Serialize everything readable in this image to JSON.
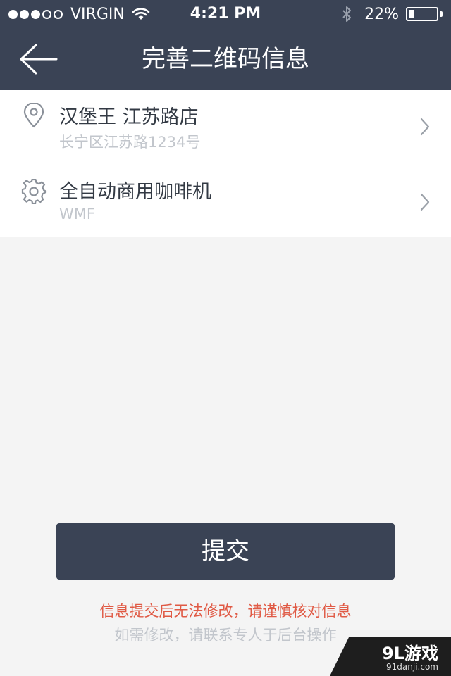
{
  "status_bar": {
    "carrier": "VIRGIN",
    "time": "4:21 PM",
    "battery_percent": "22%",
    "battery_level": 0.22,
    "signal_bars_filled": 3,
    "signal_bars_total": 5,
    "icons": [
      "wifi-icon",
      "bluetooth-icon",
      "battery-icon"
    ]
  },
  "nav": {
    "title": "完善二维码信息",
    "back_icon": "arrow-left-icon"
  },
  "list": {
    "items": [
      {
        "icon": "location-pin-icon",
        "title": "汉堡王 江苏路店",
        "subtitle": "长宁区江苏路1234号"
      },
      {
        "icon": "gear-icon",
        "title": "全自动商用咖啡机",
        "subtitle": "WMF"
      }
    ]
  },
  "submit": {
    "label": "提交"
  },
  "notice": {
    "warning": "信息提交后无法修改，请谨慎核对信息",
    "hint": "如需修改，请联系专人于后台操作"
  },
  "watermark": {
    "logo": "9L游戏",
    "url": "91danji.com"
  },
  "colors": {
    "header": "#3a4355",
    "background": "#f4f4f4",
    "warning": "#e05a45",
    "muted": "#c2c6cc"
  }
}
